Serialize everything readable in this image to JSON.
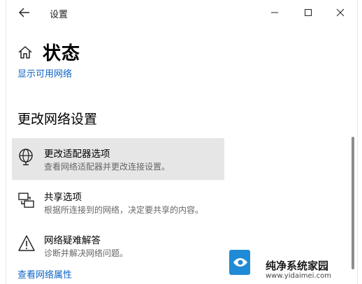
{
  "window": {
    "title": "设置",
    "back_icon": "back-arrow-icon",
    "minimize_icon": "minimize-icon",
    "maximize_icon": "maximize-icon",
    "close_icon": "close-icon"
  },
  "header": {
    "home_icon": "home-icon",
    "title": "状态",
    "link": "显示可用网络"
  },
  "section": {
    "title": "更改网络设置"
  },
  "options": [
    {
      "icon": "globe-network-icon",
      "title": "更改适配器选项",
      "subtitle": "查看网络适配器并更改连接设置。",
      "highlighted": true
    },
    {
      "icon": "sharing-icon",
      "title": "共享选项",
      "subtitle": "根据所连接到的网络，决定要共享的内容。",
      "highlighted": false
    },
    {
      "icon": "warning-triangle-icon",
      "title": "网络疑难解答",
      "subtitle": "诊断并解决网络问题。",
      "highlighted": false
    }
  ],
  "footer": {
    "link": "查看网络属性"
  },
  "watermark": {
    "title": "纯净系统家园",
    "url": "www.yidaimei.com"
  },
  "colors": {
    "link": "#0b63c5",
    "highlight": "#e6e6e6",
    "subtitle": "#666666"
  }
}
